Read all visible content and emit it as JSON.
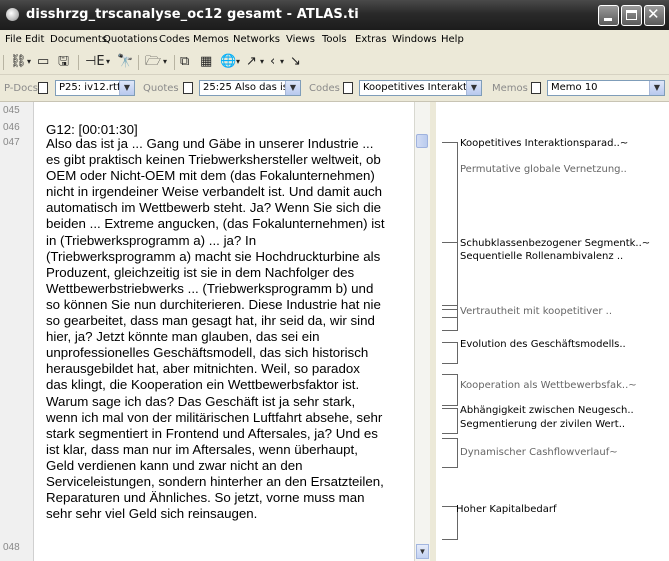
{
  "window": {
    "title": "disshrzg_trscanalyse_oc12 gesamt - ATLAS.ti"
  },
  "menu": [
    "File",
    "Edit",
    "Documents",
    "Quotations",
    "Codes",
    "Memos",
    "Networks",
    "Views",
    "Tools",
    "Extras",
    "Windows",
    "Help"
  ],
  "selectors": {
    "pdocs_label": "P-Docs",
    "pdocs_value": "P25: iv12.rtf",
    "quotes_label": "Quotes",
    "quotes_value": "25:25 Also das ist",
    "codes_label": "Codes",
    "codes_value": "Koopetitives Interaktio",
    "memos_label": "Memos",
    "memos_value": "Memo 10"
  },
  "line_numbers": [
    "045",
    "046",
    "047",
    "048"
  ],
  "document": {
    "heading": "G12: [00:01:30]",
    "lines": [
      "Also das ist ja ... Gang und Gäbe in unserer Industrie ...",
      "es gibt praktisch keinen Triebwerkshersteller weltweit, ob",
      "OEM oder Nicht-OEM mit dem (das Fokalunternehmen)",
      "nicht in irgendeiner Weise verbandelt ist. Und damit auch",
      "automatisch im Wettbewerb steht. Ja? Wenn Sie sich die",
      "beiden ... Extreme angucken, (das Fokalunternehmen) ist",
      "in (Triebwerksprogramm a) ... ja? In",
      "(Triebwerksprogramm a) macht sie Hochdruckturbine als",
      "Produzent, gleichzeitig ist sie in dem Nachfolger des",
      "Wettbewerbstriebwerks ... (Triebwerksprogramm b) und",
      "so können Sie nun durchiterieren. Diese Industrie hat nie",
      "so gearbeitet, dass man gesagt hat, ihr seid da, wir sind",
      "hier, ja? Jetzt könnte man glauben, das sei ein",
      "unprofessionelles Geschäftsmodell, das sich historisch",
      "herausgebildet hat, aber mitnichten. Weil, so paradox",
      "das klingt, die Kooperation ein Wettbewerbsfaktor ist.",
      "Warum sage ich das? Das Geschäft ist ja sehr stark,",
      "wenn ich mal von der militärischen Luftfahrt absehe, sehr",
      "stark segmentiert in Frontend und Aftersales, ja? Und es",
      "ist klar, dass man nur im Aftersales, wenn überhaupt,",
      "Geld verdienen kann und zwar nicht an den",
      "Serviceleistungen, sondern hinterher an den Ersatzteilen,",
      "Reparaturen und Ähnliches. So jetzt, vorne muss man",
      "sehr sehr viel Geld sich reinsaugen."
    ]
  },
  "margin_codes": [
    "Koopetitives Interaktionsparad..~",
    "Permutative globale Vernetzung..",
    "Schubklassenbezogener Segmentk..~",
    "Sequentielle Rollenambivalenz ..",
    "Vertrautheit mit koopetitiver ..",
    "Evolution des Geschäftsmodells..",
    "Kooperation als Wettbewerbsfak..~",
    "Abhängigkeit zwischen Neugesch..",
    "Segmentierung der zivilen Wert..",
    "Dynamischer Cashflowverlauf~",
    "Hoher Kapitalbedarf"
  ]
}
